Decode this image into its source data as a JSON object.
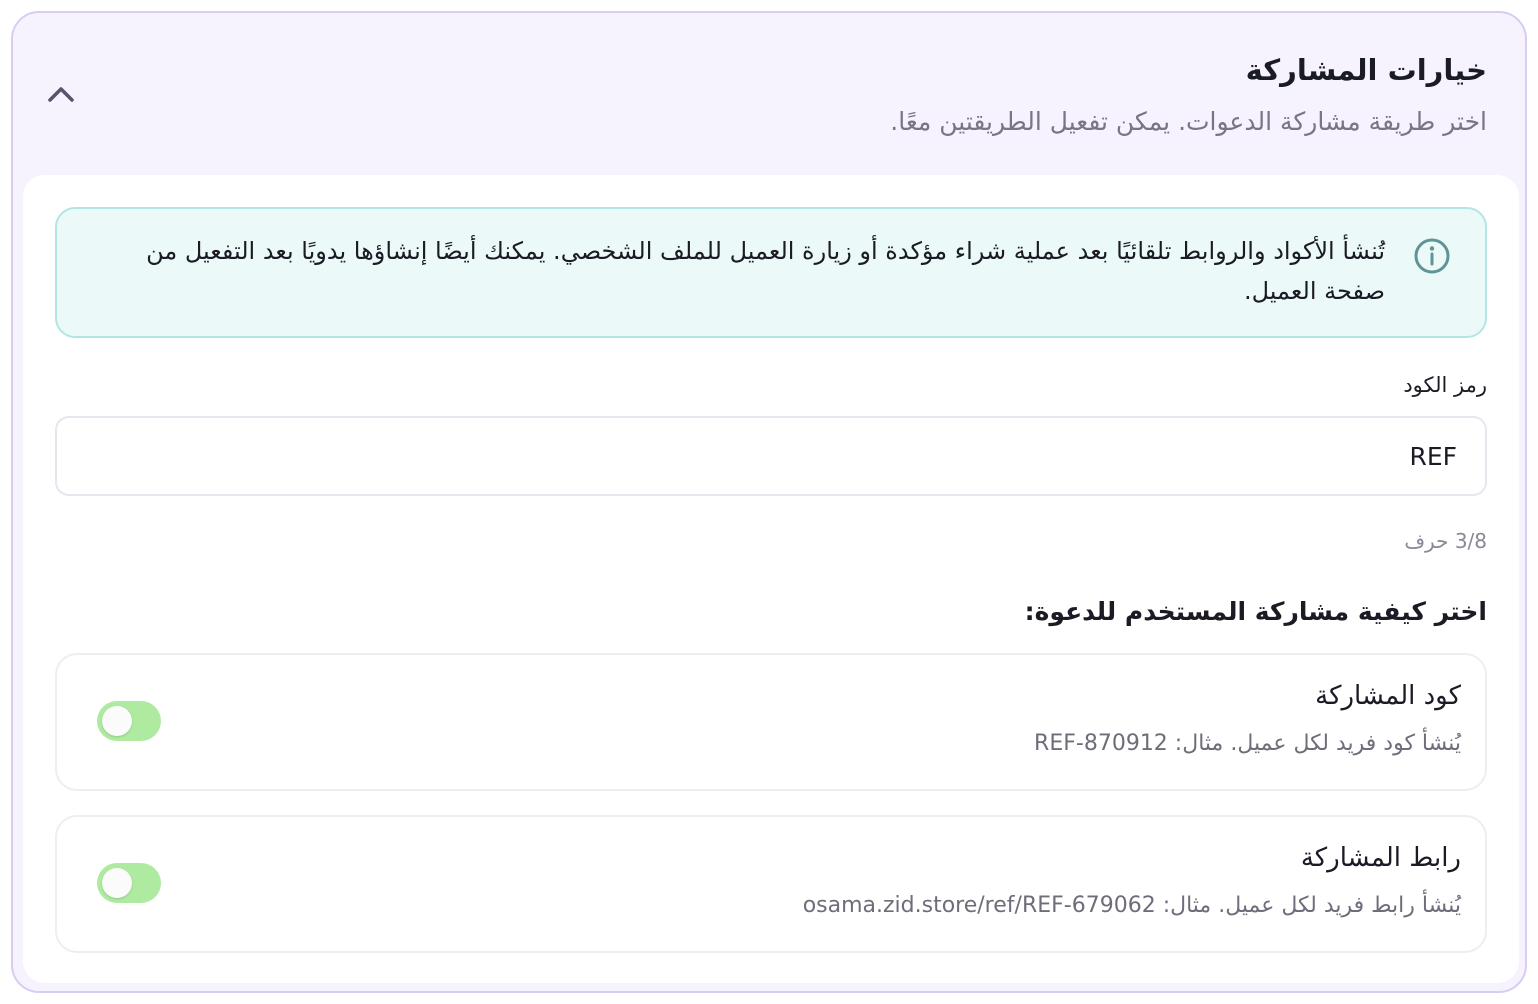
{
  "header": {
    "title": "خيارات المشاركة",
    "subtitle": "اختر طريقة مشاركة الدعوات. يمكن تفعيل الطريقتين معًا.",
    "collapse_icon": "chevron-up-icon"
  },
  "info": {
    "icon": "info-circle-icon",
    "text": "تُنشأ الأكواد والروابط تلقائيًا بعد عملية شراء مؤكدة أو زيارة العميل للملف الشخصي. يمكنك أيضًا إنشاؤها يدويًا بعد التفعيل من صفحة العميل."
  },
  "code_field": {
    "label": "رمز الكود",
    "value": "REF",
    "counter": "3/8 حرف"
  },
  "share_section": {
    "heading": "اختر كيفية مشاركة المستخدم للدعوة:",
    "options": [
      {
        "title": "كود المشاركة",
        "description": "يُنشأ كود فريد لكل عميل. مثال: REF-870912",
        "enabled": true
      },
      {
        "title": "رابط المشاركة",
        "description": "يُنشأ رابط فريد لكل عميل. مثال: osama.zid.store/ref/REF-679062",
        "enabled": true
      }
    ]
  },
  "colors": {
    "panel_background": "#f6f3fe",
    "panel_border": "#d9ccf2",
    "info_background": "#ecf9f9",
    "info_border": "#b3e6e3",
    "info_icon": "#5e9493",
    "toggle_track": "#aeeaa0"
  }
}
